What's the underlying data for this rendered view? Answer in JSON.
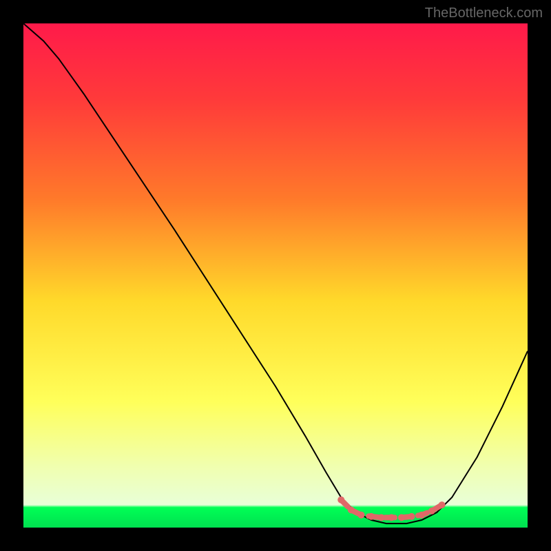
{
  "watermark": "TheBottleneck.com",
  "chart_data": {
    "type": "line",
    "title": "",
    "xlabel": "",
    "ylabel": "",
    "xlim": [
      0,
      100
    ],
    "ylim": [
      0,
      100
    ],
    "gradient_stops": [
      {
        "offset": 0,
        "color": "#ff1a4a"
      },
      {
        "offset": 0.15,
        "color": "#ff3a3a"
      },
      {
        "offset": 0.35,
        "color": "#ff7a2a"
      },
      {
        "offset": 0.55,
        "color": "#ffd92a"
      },
      {
        "offset": 0.75,
        "color": "#ffff5a"
      },
      {
        "offset": 0.88,
        "color": "#f0ffb0"
      },
      {
        "offset": 0.955,
        "color": "#e8ffd8"
      },
      {
        "offset": 0.96,
        "color": "#00ff55"
      },
      {
        "offset": 1.0,
        "color": "#00e050"
      }
    ],
    "series": [
      {
        "name": "bottleneck-curve",
        "color": "#000000",
        "points": [
          {
            "x": 0,
            "y": 100
          },
          {
            "x": 4,
            "y": 96.5
          },
          {
            "x": 7,
            "y": 93
          },
          {
            "x": 12,
            "y": 86
          },
          {
            "x": 20,
            "y": 74
          },
          {
            "x": 30,
            "y": 59
          },
          {
            "x": 40,
            "y": 43.5
          },
          {
            "x": 50,
            "y": 28
          },
          {
            "x": 56,
            "y": 18
          },
          {
            "x": 60,
            "y": 11
          },
          {
            "x": 63,
            "y": 6
          },
          {
            "x": 66,
            "y": 3
          },
          {
            "x": 69,
            "y": 1.5
          },
          {
            "x": 72,
            "y": 0.8
          },
          {
            "x": 76,
            "y": 0.8
          },
          {
            "x": 79,
            "y": 1.5
          },
          {
            "x": 82,
            "y": 3
          },
          {
            "x": 85,
            "y": 6
          },
          {
            "x": 90,
            "y": 14
          },
          {
            "x": 95,
            "y": 24
          },
          {
            "x": 100,
            "y": 35
          }
        ]
      },
      {
        "name": "marker-band",
        "color": "#e06868",
        "points": [
          {
            "x": 63,
            "y": 5.5
          },
          {
            "x": 65,
            "y": 3.5
          },
          {
            "x": 67,
            "y": 2.5
          },
          {
            "x": 69,
            "y": 2.2
          },
          {
            "x": 71,
            "y": 2.0
          },
          {
            "x": 73,
            "y": 2.0
          },
          {
            "x": 75,
            "y": 2.0
          },
          {
            "x": 77,
            "y": 2.2
          },
          {
            "x": 79,
            "y": 2.5
          },
          {
            "x": 81,
            "y": 3.3
          },
          {
            "x": 83,
            "y": 4.5
          }
        ]
      }
    ]
  }
}
